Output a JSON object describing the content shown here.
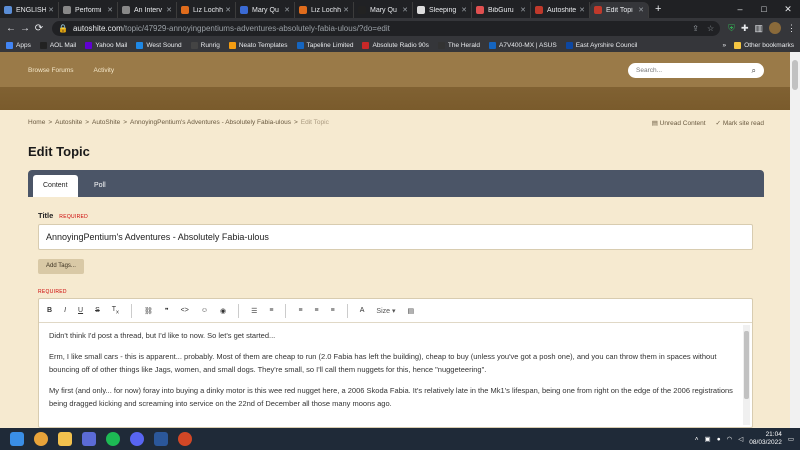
{
  "browser": {
    "tabs": [
      {
        "title": "ENGLISH",
        "color": "#5a8dd6"
      },
      {
        "title": "Performi",
        "color": "#888"
      },
      {
        "title": "An Interv",
        "color": "#888"
      },
      {
        "title": "Liz Lochh",
        "color": "#e06c1c"
      },
      {
        "title": "Mary Qu",
        "color": "#3a6ad4"
      },
      {
        "title": "Liz Lochh",
        "color": "#e06c1c"
      },
      {
        "title": "Mary Qu",
        "color": "#222"
      },
      {
        "title": "Sleeping",
        "color": "#ddd"
      },
      {
        "title": "BibGuru",
        "color": "#e05050"
      },
      {
        "title": "Autoshite",
        "color": "#c0392b"
      },
      {
        "title": "Edit Topi",
        "color": "#c0392b"
      }
    ],
    "new_tab": "+",
    "url_host": "autoshite.com",
    "url_path": "/topic/47929-annoyingpentiums-adventures-absolutely-fabia-ulous/?do=edit",
    "bookmarks": [
      {
        "label": "Apps",
        "color": "#4285f4"
      },
      {
        "label": "AOL Mail",
        "color": "#222"
      },
      {
        "label": "Yahoo Mail",
        "color": "#6001d2"
      },
      {
        "label": "West Sound",
        "color": "#1e88e5"
      },
      {
        "label": "Runrig",
        "color": "#444"
      },
      {
        "label": "Neato Templates",
        "color": "#f39c12"
      },
      {
        "label": "Tapeline Limited",
        "color": "#1565c0"
      },
      {
        "label": "Absolute Radio 90s",
        "color": "#c62828"
      },
      {
        "label": "The Herald",
        "color": "#333"
      },
      {
        "label": "A7V400-MX | ASUS",
        "color": "#1565c0"
      },
      {
        "label": "East Ayrshire Council",
        "color": "#0d47a1"
      }
    ],
    "bookmarks_more": "»",
    "other_bookmarks": "Other bookmarks"
  },
  "site": {
    "nav": [
      "Browse Forums",
      "Activity"
    ],
    "search_placeholder": "Search..."
  },
  "breadcrumb": {
    "items": [
      "Home",
      "Autoshite",
      "AutoShite",
      "AnnoyingPentium's Adventures - Absolutely Fabia-ulous"
    ],
    "current": "Edit Topic",
    "separator": ">",
    "actions": {
      "unread": "Unread Content",
      "mark_read": "Mark site read"
    }
  },
  "page": {
    "title": "Edit Topic",
    "tabs": {
      "content": "Content",
      "poll": "Poll"
    },
    "title_label": "Title",
    "required": "REQUIRED",
    "title_value": "AnnoyingPentium's Adventures - Absolutely Fabia-ulous",
    "add_tags": "Add Tags...",
    "editor_size_label": "Size",
    "body_paragraphs": [
      "Didn't think I'd post a thread, but I'd like to now. So let's get started...",
      "Erm, I like small cars - this is apparent... probably. Most of them are cheap to run (2.0 Fabia has left the building), cheap to buy (unless you've got a posh one), and you can throw them in spaces without bouncing off of other things like Jags, women, and small dogs. They're small, so I'll call them nuggets for this, hence \"nuggeteering\".",
      "My first (and only... for now) foray into buying a dinky motor is this wee red nugget here, a 2006 Skoda Fabia. It's relatively late in the Mk1's lifespan, being one from right on the edge of the 2006 registrations being dragged kicking and screaming into service on the 22nd of December all those many moons ago."
    ]
  },
  "taskbar": {
    "time": "21:04",
    "date": "08/03/2022"
  }
}
